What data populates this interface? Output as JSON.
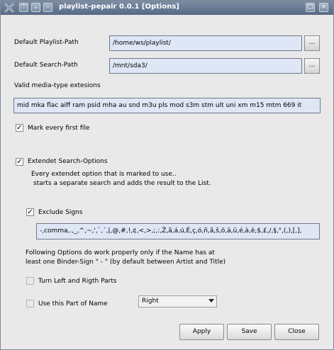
{
  "window": {
    "title": "playlist-pepair 0.0.1 [Options]"
  },
  "paths": {
    "playlist_label": "Default Playlist-Path",
    "playlist_value": "/home/ws/playlist/",
    "search_label": "Default Search-Path",
    "search_value": "/mnt/sda3/",
    "browse_label": "..."
  },
  "media": {
    "label": "Valid media-type extesions",
    "value": "mid mka flac aiff ram psid mha au snd m3u pls mod s3m stm ult uni xm m15 mtm 669 it"
  },
  "mark_first": {
    "label": "Mark every first file",
    "checked": true
  },
  "extended": {
    "label": "Extendet Search-Options",
    "checked": true,
    "desc_line1": "Every extendet option that is marked to use..",
    "desc_line2": "starts a separate search and adds the result to the List."
  },
  "exclude": {
    "label": "Exclude Signs",
    "checked": true,
    "value": "-,comma,.,_,^,~,',`,´,|,@,#,!,¢,<,>,;,:,Ž,ã,á,ú,É,ç,ó,ñ,ã,š,ö,ä,ü,é,à,è,$,£,/,§,°,(,),[,],"
  },
  "binder_note": {
    "line1": "Following Options do work properly only if the Name has at",
    "line2": "least one Binder-Sign \" - \" (by default between Artist and Title)"
  },
  "turn_parts": {
    "label": "Turn Left and Rigth Parts",
    "checked": false
  },
  "use_part": {
    "label": "Use this Part of Name",
    "checked": false,
    "selected": "Right"
  },
  "buttons": {
    "apply": "Apply",
    "save": "Save",
    "close": "Close"
  }
}
